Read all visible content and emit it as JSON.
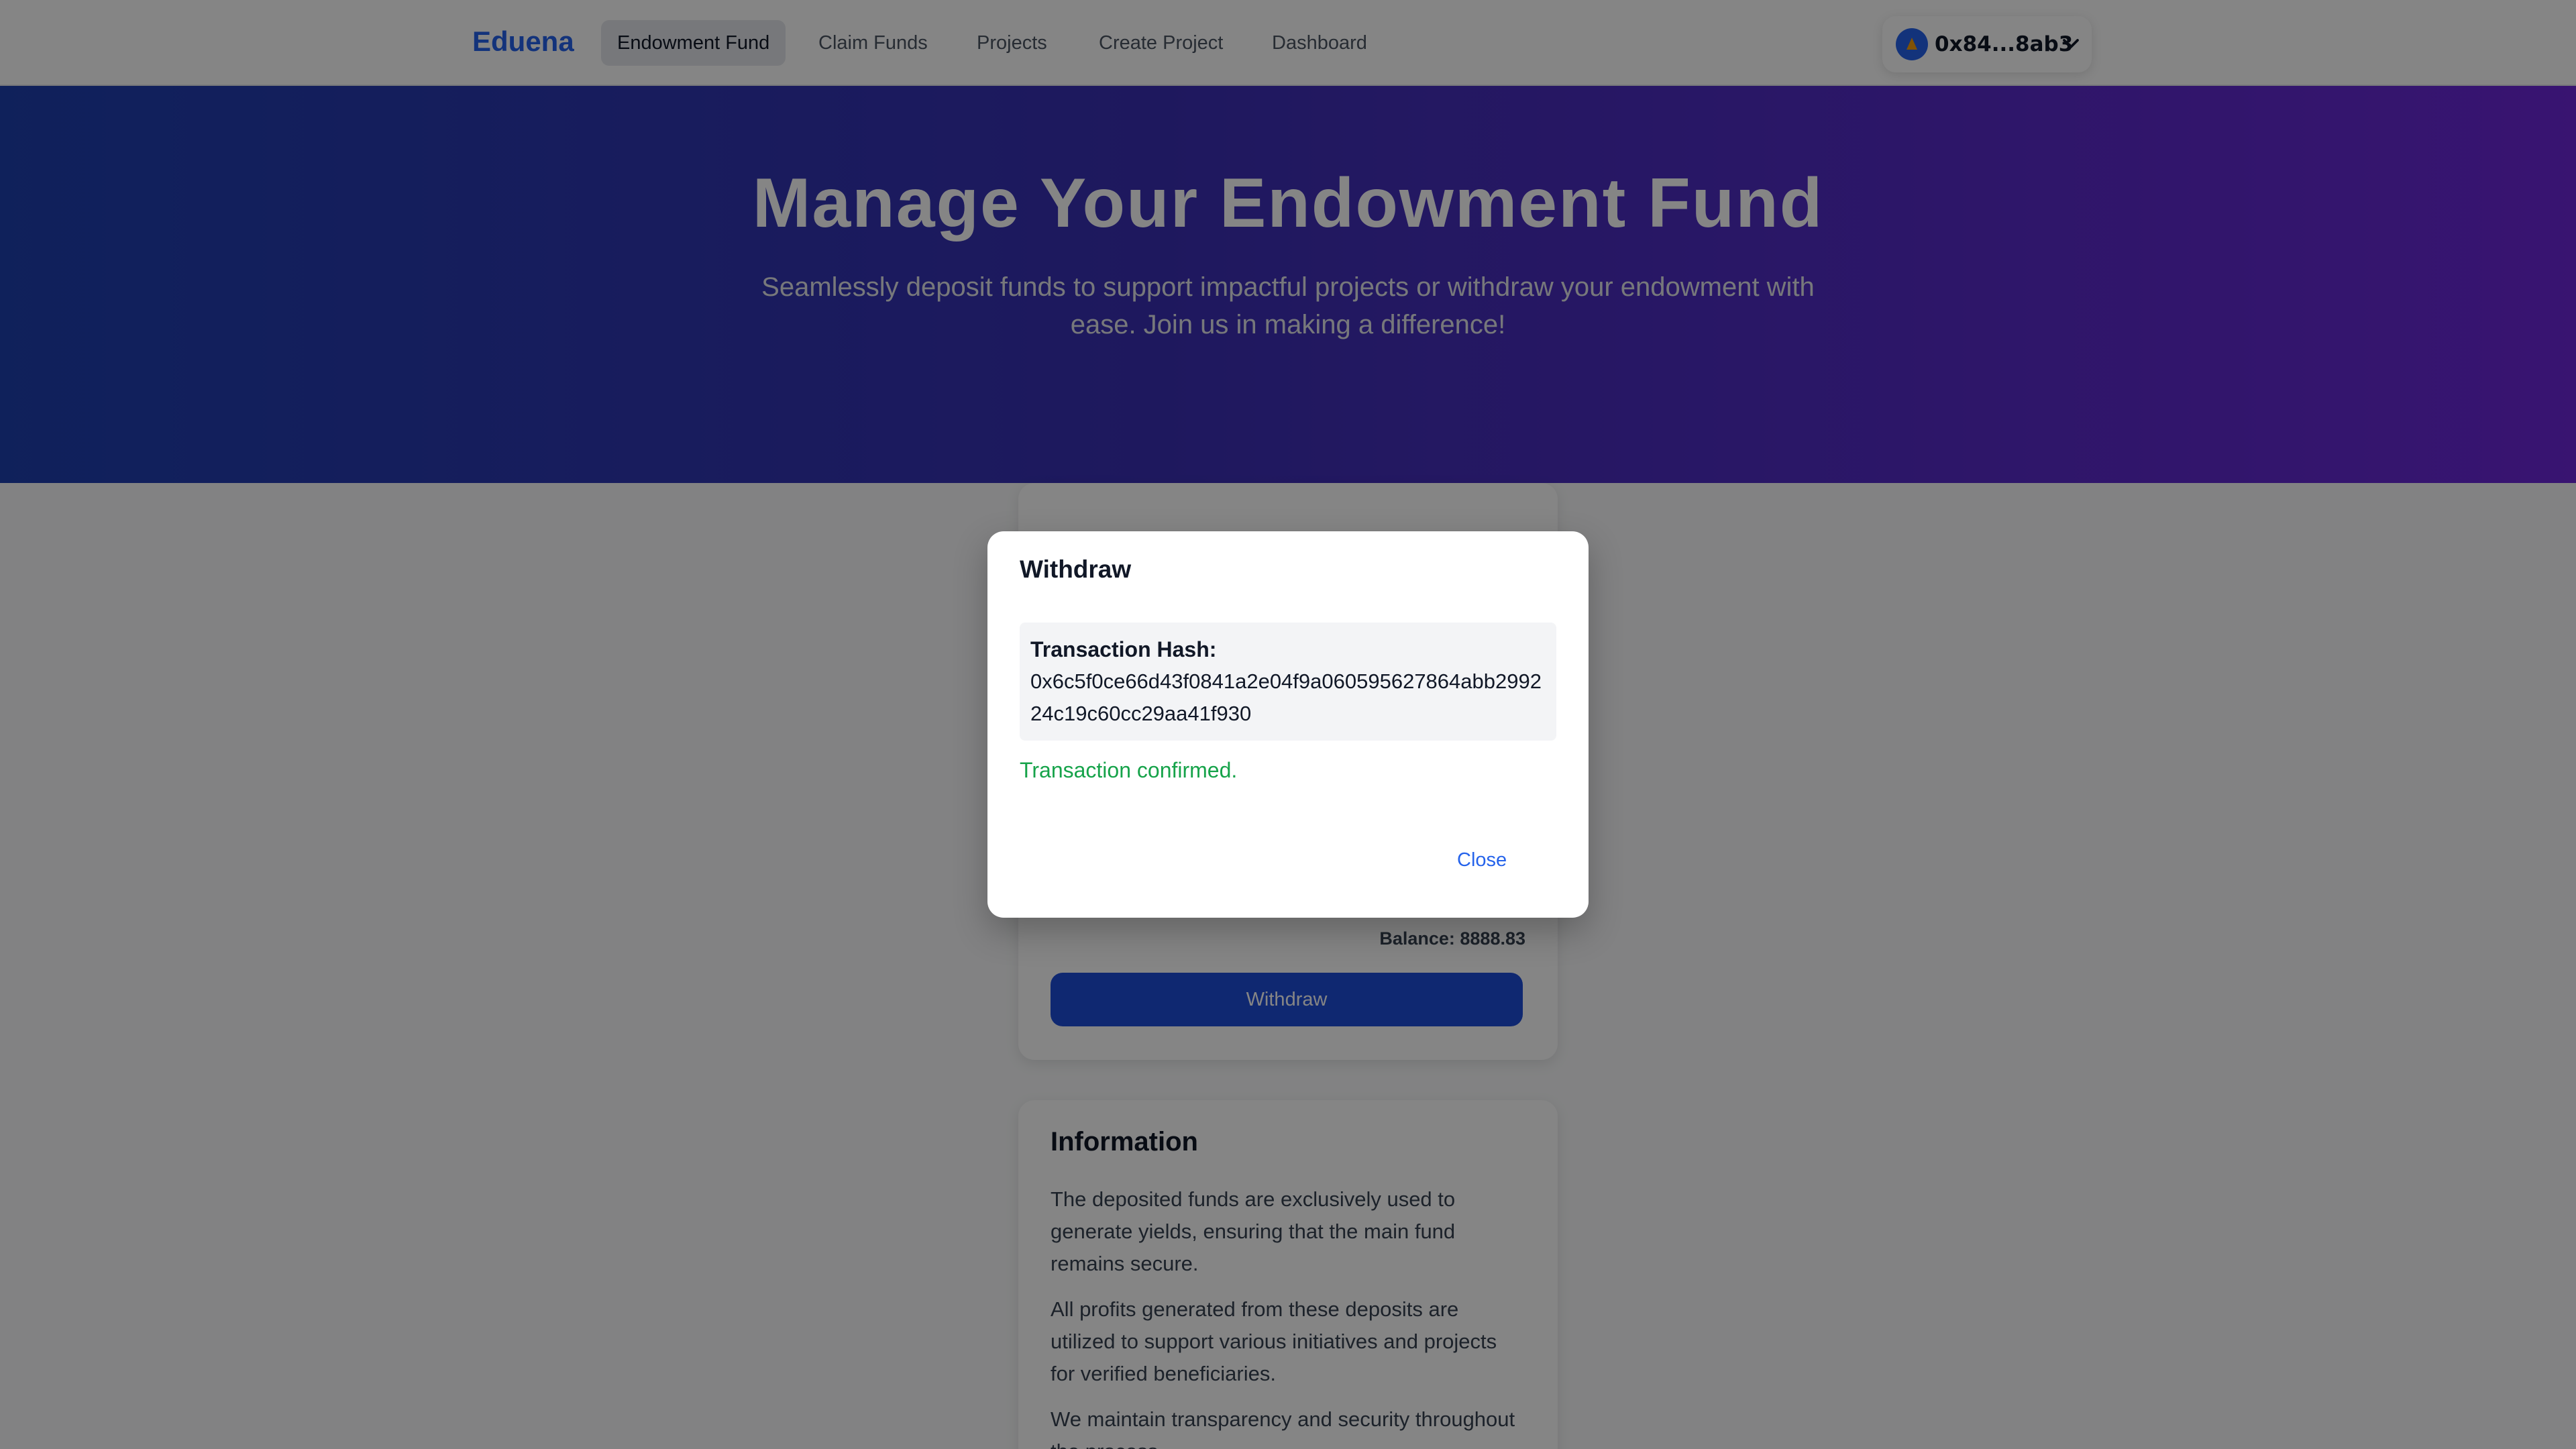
{
  "nav": {
    "brand": "Eduena",
    "items": [
      {
        "label": "Endowment Fund",
        "active": true
      },
      {
        "label": "Claim Funds"
      },
      {
        "label": "Projects"
      },
      {
        "label": "Create Project"
      },
      {
        "label": "Dashboard"
      }
    ],
    "wallet": {
      "address": "0x84...8ab3",
      "avatar_icon": "wallet-avatar-icon",
      "chevron_icon": "chevron-down-icon"
    }
  },
  "hero": {
    "title": "Manage Your Endowment Fund",
    "subtitle": "Seamlessly deposit funds to support impactful projects or withdraw your endowment with ease. Join us in making a difference!"
  },
  "withdraw_card": {
    "balance": "Balance: 8888.83",
    "button": "Withdraw"
  },
  "info_card": {
    "title": "Information",
    "paragraphs": [
      "The deposited funds are exclusively used to generate yields, ensuring that the main fund remains secure.",
      "All profits generated from these deposits are utilized to support various initiatives and projects for verified beneficiaries.",
      "We maintain transparency and security throughout the process."
    ]
  },
  "modal": {
    "title": "Withdraw",
    "hash_label": "Transaction Hash:",
    "hash_value": "0x6c5f0ce66d43f0841a2e04f9a060595627864abb299224c19c60cc29aa41f930",
    "status": "Transaction confirmed.",
    "close": "Close"
  },
  "colors": {
    "brand": "#2563eb",
    "hero_gradient_start": "#1e40af",
    "hero_gradient_end": "#6d28d9",
    "primary_button": "#1d4ed8",
    "success": "#16a34a"
  }
}
